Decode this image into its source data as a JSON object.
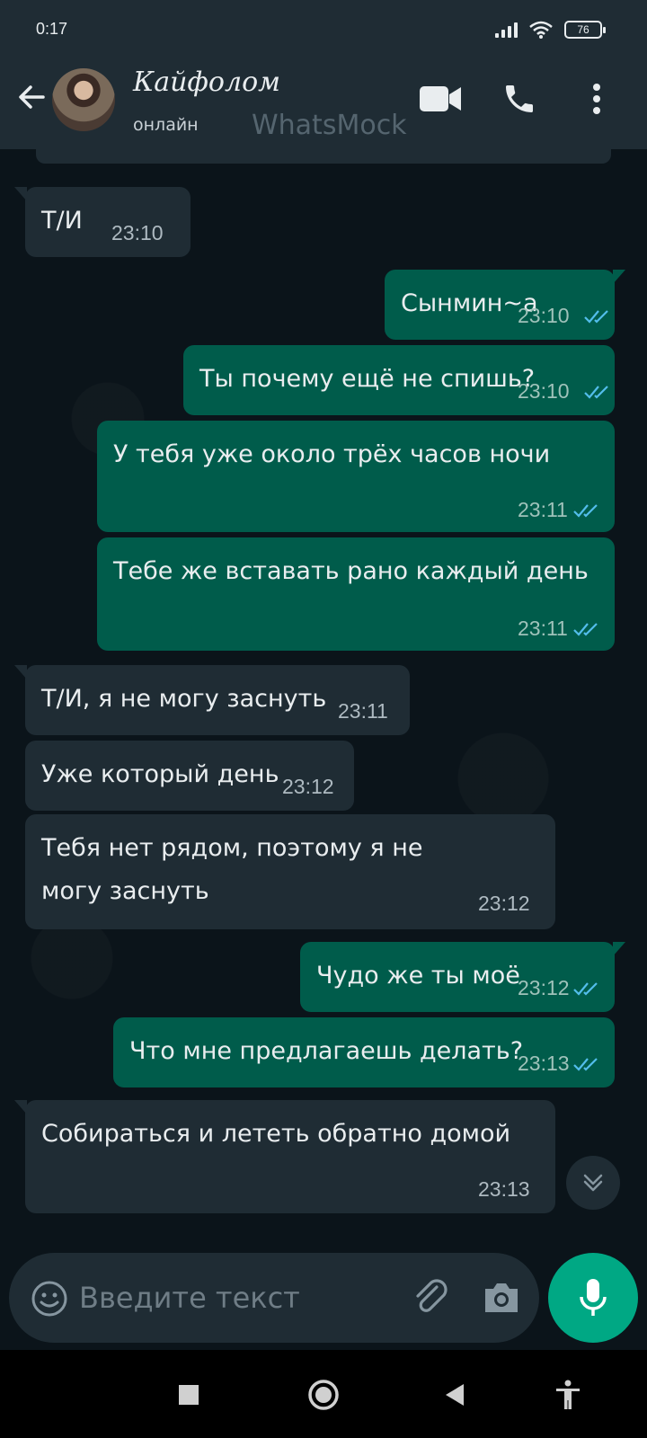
{
  "status_bar": {
    "time": "0:17",
    "battery": "76"
  },
  "header": {
    "contact_name": "Кайфолом",
    "contact_status": "онлайн",
    "watermark": "WhatsMock",
    "icons": [
      "back-arrow-icon",
      "video-call-icon",
      "phone-icon",
      "more-vert-icon"
    ]
  },
  "messages": [
    {
      "dir": "in",
      "text": "Т/И",
      "time": "23:10"
    },
    {
      "dir": "out",
      "text": "Сынмин~а",
      "time": "23:10",
      "status": "read"
    },
    {
      "dir": "out",
      "text": "Ты почему ещё не спишь?",
      "time": "23:10",
      "status": "read"
    },
    {
      "dir": "out",
      "text": "У тебя уже около трёх часов ночи",
      "time": "23:11",
      "status": "read"
    },
    {
      "dir": "out",
      "text": "Тебе же вставать рано каждый день",
      "time": "23:11",
      "status": "read"
    },
    {
      "dir": "in",
      "text": "Т/И, я не могу заснуть",
      "time": "23:11"
    },
    {
      "dir": "in",
      "text": "Уже который день",
      "time": "23:12"
    },
    {
      "dir": "in",
      "text": "Тебя нет рядом, поэтому я не могу заснуть",
      "time": "23:12"
    },
    {
      "dir": "out",
      "text": "Чудо же ты моё",
      "time": "23:12",
      "status": "read"
    },
    {
      "dir": "out",
      "text": "Что мне предлагаешь делать?",
      "time": "23:13",
      "status": "read"
    },
    {
      "dir": "in",
      "text": "Собираться и лететь обратно домой",
      "time": "23:13"
    }
  ],
  "composer": {
    "placeholder": "Введите текст"
  },
  "colors": {
    "incoming": "#1f2c34",
    "outgoing": "#005c4b",
    "accent": "#00a884",
    "read_ticks": "#53bdeb"
  }
}
